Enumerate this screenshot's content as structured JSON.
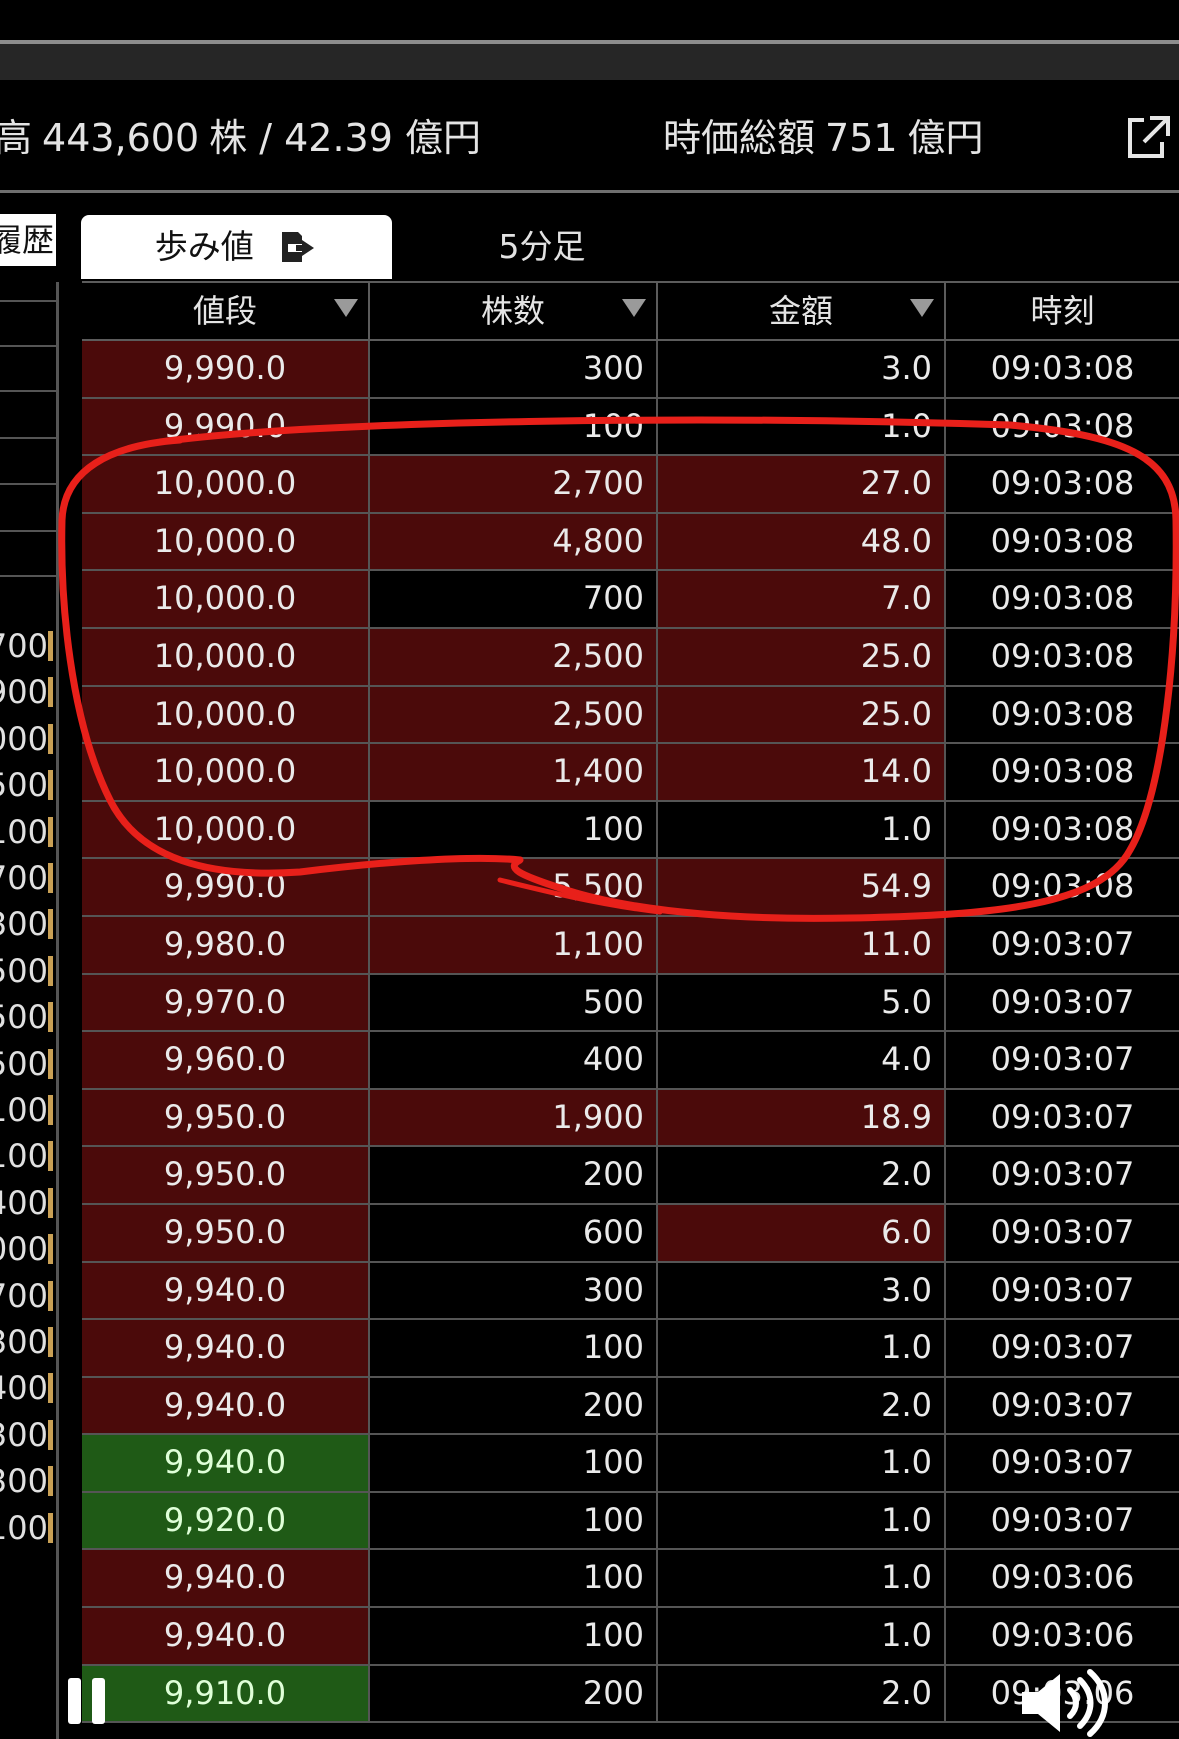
{
  "info": {
    "volume_label": "高",
    "volume_value": "443,600",
    "volume_unit": "株 / 42.39 億円",
    "market_cap_label": "時価総額",
    "market_cap_value": "751",
    "market_cap_unit": "億円"
  },
  "left_panel": {
    "tab_label": "履歴",
    "values": [
      "700",
      "900",
      "000",
      "500",
      "100",
      "700",
      "300",
      "500",
      "500",
      "500",
      "100",
      "100",
      "400",
      "000",
      "700",
      "300",
      "400",
      "300",
      "300",
      "100"
    ]
  },
  "tabs": [
    {
      "label": "歩み値",
      "active": true
    },
    {
      "label": "5分足",
      "active": false
    }
  ],
  "table": {
    "headers": [
      "値段",
      "株数",
      "金額",
      "時刻"
    ],
    "rows": [
      {
        "price": "9,990.0",
        "qty": "300",
        "amount": "3.0",
        "time": "09:03:08",
        "pc": "red",
        "qc": "black",
        "ac": "black"
      },
      {
        "price": "9,990.0",
        "qty": "100",
        "amount": "1.0",
        "time": "09:03:08",
        "pc": "red",
        "qc": "black",
        "ac": "black"
      },
      {
        "price": "10,000.0",
        "qty": "2,700",
        "amount": "27.0",
        "time": "09:03:08",
        "pc": "red",
        "qc": "red",
        "ac": "red"
      },
      {
        "price": "10,000.0",
        "qty": "4,800",
        "amount": "48.0",
        "time": "09:03:08",
        "pc": "red",
        "qc": "red",
        "ac": "red"
      },
      {
        "price": "10,000.0",
        "qty": "700",
        "amount": "7.0",
        "time": "09:03:08",
        "pc": "red",
        "qc": "black",
        "ac": "red"
      },
      {
        "price": "10,000.0",
        "qty": "2,500",
        "amount": "25.0",
        "time": "09:03:08",
        "pc": "red",
        "qc": "red",
        "ac": "red"
      },
      {
        "price": "10,000.0",
        "qty": "2,500",
        "amount": "25.0",
        "time": "09:03:08",
        "pc": "red",
        "qc": "red",
        "ac": "red"
      },
      {
        "price": "10,000.0",
        "qty": "1,400",
        "amount": "14.0",
        "time": "09:03:08",
        "pc": "red",
        "qc": "red",
        "ac": "red"
      },
      {
        "price": "10,000.0",
        "qty": "100",
        "amount": "1.0",
        "time": "09:03:08",
        "pc": "red",
        "qc": "black",
        "ac": "black"
      },
      {
        "price": "9,990.0",
        "qty": "5,500",
        "amount": "54.9",
        "time": "09:03:08",
        "pc": "red",
        "qc": "red",
        "ac": "red"
      },
      {
        "price": "9,980.0",
        "qty": "1,100",
        "amount": "11.0",
        "time": "09:03:07",
        "pc": "red",
        "qc": "red",
        "ac": "red"
      },
      {
        "price": "9,970.0",
        "qty": "500",
        "amount": "5.0",
        "time": "09:03:07",
        "pc": "red",
        "qc": "black",
        "ac": "black"
      },
      {
        "price": "9,960.0",
        "qty": "400",
        "amount": "4.0",
        "time": "09:03:07",
        "pc": "red",
        "qc": "black",
        "ac": "black"
      },
      {
        "price": "9,950.0",
        "qty": "1,900",
        "amount": "18.9",
        "time": "09:03:07",
        "pc": "red",
        "qc": "red",
        "ac": "red"
      },
      {
        "price": "9,950.0",
        "qty": "200",
        "amount": "2.0",
        "time": "09:03:07",
        "pc": "red",
        "qc": "black",
        "ac": "black"
      },
      {
        "price": "9,950.0",
        "qty": "600",
        "amount": "6.0",
        "time": "09:03:07",
        "pc": "red",
        "qc": "black",
        "ac": "red"
      },
      {
        "price": "9,940.0",
        "qty": "300",
        "amount": "3.0",
        "time": "09:03:07",
        "pc": "red",
        "qc": "black",
        "ac": "black"
      },
      {
        "price": "9,940.0",
        "qty": "100",
        "amount": "1.0",
        "time": "09:03:07",
        "pc": "red",
        "qc": "black",
        "ac": "black"
      },
      {
        "price": "9,940.0",
        "qty": "200",
        "amount": "2.0",
        "time": "09:03:07",
        "pc": "red",
        "qc": "black",
        "ac": "black"
      },
      {
        "price": "9,940.0",
        "qty": "100",
        "amount": "1.0",
        "time": "09:03:07",
        "pc": "green",
        "qc": "black",
        "ac": "black"
      },
      {
        "price": "9,920.0",
        "qty": "100",
        "amount": "1.0",
        "time": "09:03:07",
        "pc": "green",
        "qc": "black",
        "ac": "black"
      },
      {
        "price": "9,940.0",
        "qty": "100",
        "amount": "1.0",
        "time": "09:03:06",
        "pc": "red",
        "qc": "black",
        "ac": "black"
      },
      {
        "price": "9,940.0",
        "qty": "100",
        "amount": "1.0",
        "time": "09:03:06",
        "pc": "red",
        "qc": "black",
        "ac": "black"
      },
      {
        "price": "9,910.0",
        "qty": "200",
        "amount": "2.0",
        "time": "09:03:06",
        "pc": "green",
        "qc": "black",
        "ac": "black"
      }
    ]
  },
  "colors": {
    "up_bg": "#4b0a0a",
    "down_bg": "#1f5a16",
    "annotation": "#e8201a"
  },
  "icons": [
    "external-link-icon",
    "export-icon",
    "sort-down-icon",
    "pause-icon",
    "volume-icon"
  ]
}
